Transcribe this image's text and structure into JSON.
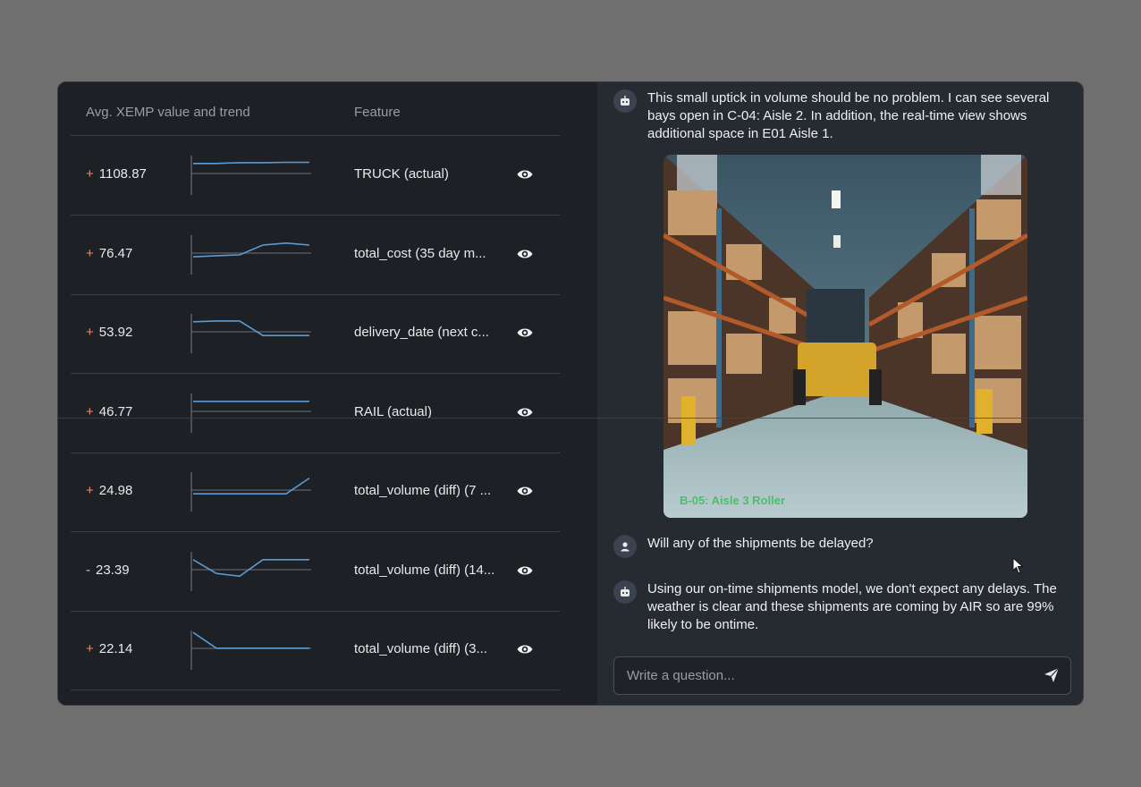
{
  "table": {
    "header": {
      "col1": "Avg. XEMP value and trend",
      "col2": "Feature"
    },
    "rows": [
      {
        "sign": "+",
        "value": "1108.87",
        "feature": "TRUCK (actual)",
        "trend": [
          0.2,
          0.2,
          0.18,
          0.18,
          0.17,
          0.17
        ]
      },
      {
        "sign": "+",
        "value": "76.47",
        "feature": "total_cost (35 day m...",
        "trend": [
          0.55,
          0.52,
          0.5,
          0.25,
          0.2,
          0.25
        ]
      },
      {
        "sign": "+",
        "value": "53.92",
        "feature": "delivery_date (next c...",
        "trend": [
          0.2,
          0.18,
          0.18,
          0.55,
          0.55,
          0.55
        ]
      },
      {
        "sign": "+",
        "value": "46.77",
        "feature": "RAIL (actual)",
        "trend": [
          0.2,
          0.2,
          0.2,
          0.2,
          0.2,
          0.2
        ]
      },
      {
        "sign": "+",
        "value": "24.98",
        "feature": "total_volume (diff) (7 ...",
        "trend": [
          0.55,
          0.55,
          0.55,
          0.55,
          0.55,
          0.15
        ]
      },
      {
        "sign": "-",
        "value": "23.39",
        "feature": "total_volume (diff) (14...",
        "trend": [
          0.2,
          0.55,
          0.62,
          0.2,
          0.2,
          0.2
        ]
      },
      {
        "sign": "+",
        "value": "22.14",
        "feature": "total_volume (diff) (3...",
        "trend": [
          0.05,
          0.45,
          0.45,
          0.45,
          0.45,
          0.45
        ]
      }
    ]
  },
  "chat": {
    "messages": [
      {
        "role": "bot",
        "text": "This small uptick in volume should be no problem. I can see several bays open in C-04: Aisle 2. In addition, the real-time view shows additional space in E01 Aisle 1."
      },
      {
        "role": "user",
        "text": "Will any of the shipments be delayed?"
      },
      {
        "role": "bot",
        "text": "Using our on-time shipments model, we don't expect any delays. The weather is clear and these shipments are coming by AIR so are 99% likely to be ontime."
      }
    ],
    "image_caption": "B-05: Aisle 3 Roller",
    "input_placeholder": "Write a question..."
  },
  "colors": {
    "positive_sign": "#e2906c",
    "trend_line": "#5b9bd5",
    "accent_text": "#eef0f2"
  },
  "icons": [
    "robot-icon",
    "user-icon",
    "eye-icon",
    "send-icon",
    "mouse-cursor-icon"
  ]
}
